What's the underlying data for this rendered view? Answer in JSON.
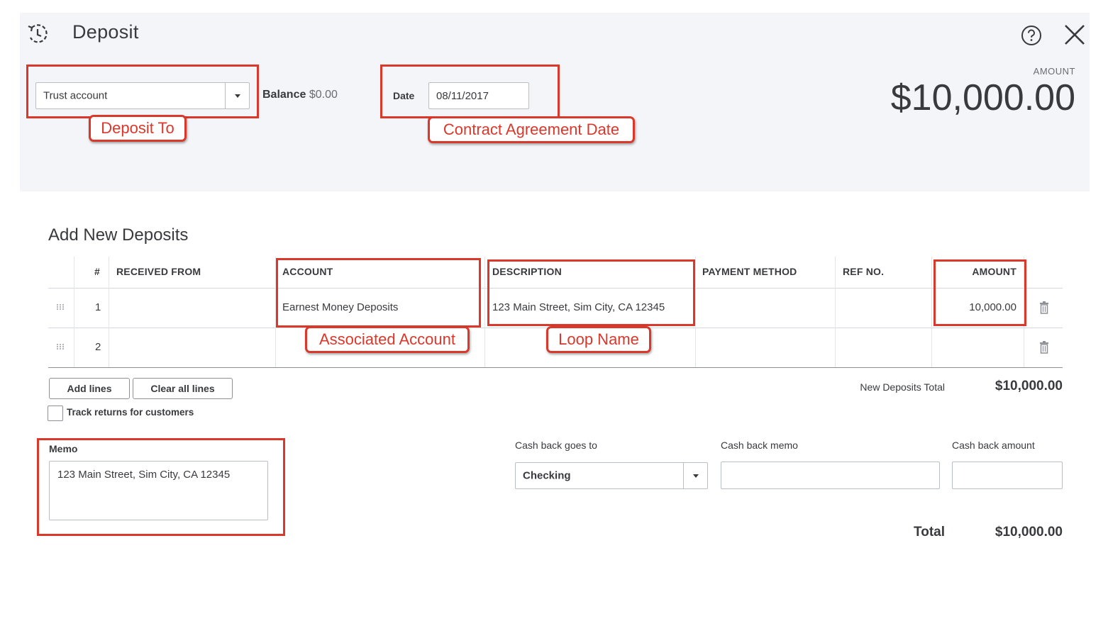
{
  "header": {
    "title": "Deposit",
    "deposit_to": {
      "value": "Trust account"
    },
    "balance": {
      "label": "Balance",
      "value": "$0.00"
    },
    "date": {
      "label": "Date",
      "value": "08/11/2017"
    },
    "amount": {
      "label": "AMOUNT",
      "value": "$10,000.00"
    }
  },
  "annotations": {
    "deposit_to": "Deposit To",
    "contract_date": "Contract Agreement Date",
    "associated_account": "Associated Account",
    "loop_name": "Loop Name"
  },
  "deposits": {
    "title": "Add New Deposits",
    "columns": [
      "#",
      "RECEIVED FROM",
      "ACCOUNT",
      "DESCRIPTION",
      "PAYMENT METHOD",
      "REF NO.",
      "AMOUNT"
    ],
    "rows": [
      {
        "num": "1",
        "received_from": "",
        "account": "Earnest Money Deposits",
        "description": "123 Main Street, Sim City, CA 12345",
        "payment_method": "",
        "ref_no": "",
        "amount": "10,000.00"
      },
      {
        "num": "2",
        "received_from": "",
        "account": "",
        "description": "",
        "payment_method": "",
        "ref_no": "",
        "amount": ""
      }
    ],
    "add_lines_label": "Add lines",
    "clear_lines_label": "Clear all lines",
    "track_returns_label": "Track returns for customers",
    "new_total_label": "New Deposits Total",
    "new_total_value": "$10,000.00"
  },
  "memo": {
    "label": "Memo",
    "value": "123 Main Street, Sim City, CA 12345"
  },
  "cash_back": {
    "goes_to_label": "Cash back goes to",
    "goes_to_value": "Checking",
    "memo_label": "Cash back memo",
    "memo_value": "",
    "amount_label": "Cash back amount",
    "amount_value": ""
  },
  "total": {
    "label": "Total",
    "value": "$10,000.00"
  },
  "colors": {
    "accent_red": "#d9382b",
    "header_bg": "#f4f5f8",
    "text": "#393a3d"
  },
  "icons": [
    "history-icon",
    "help-icon",
    "close-icon",
    "chevron-down-icon",
    "drag-handle-icon",
    "trash-icon"
  ]
}
